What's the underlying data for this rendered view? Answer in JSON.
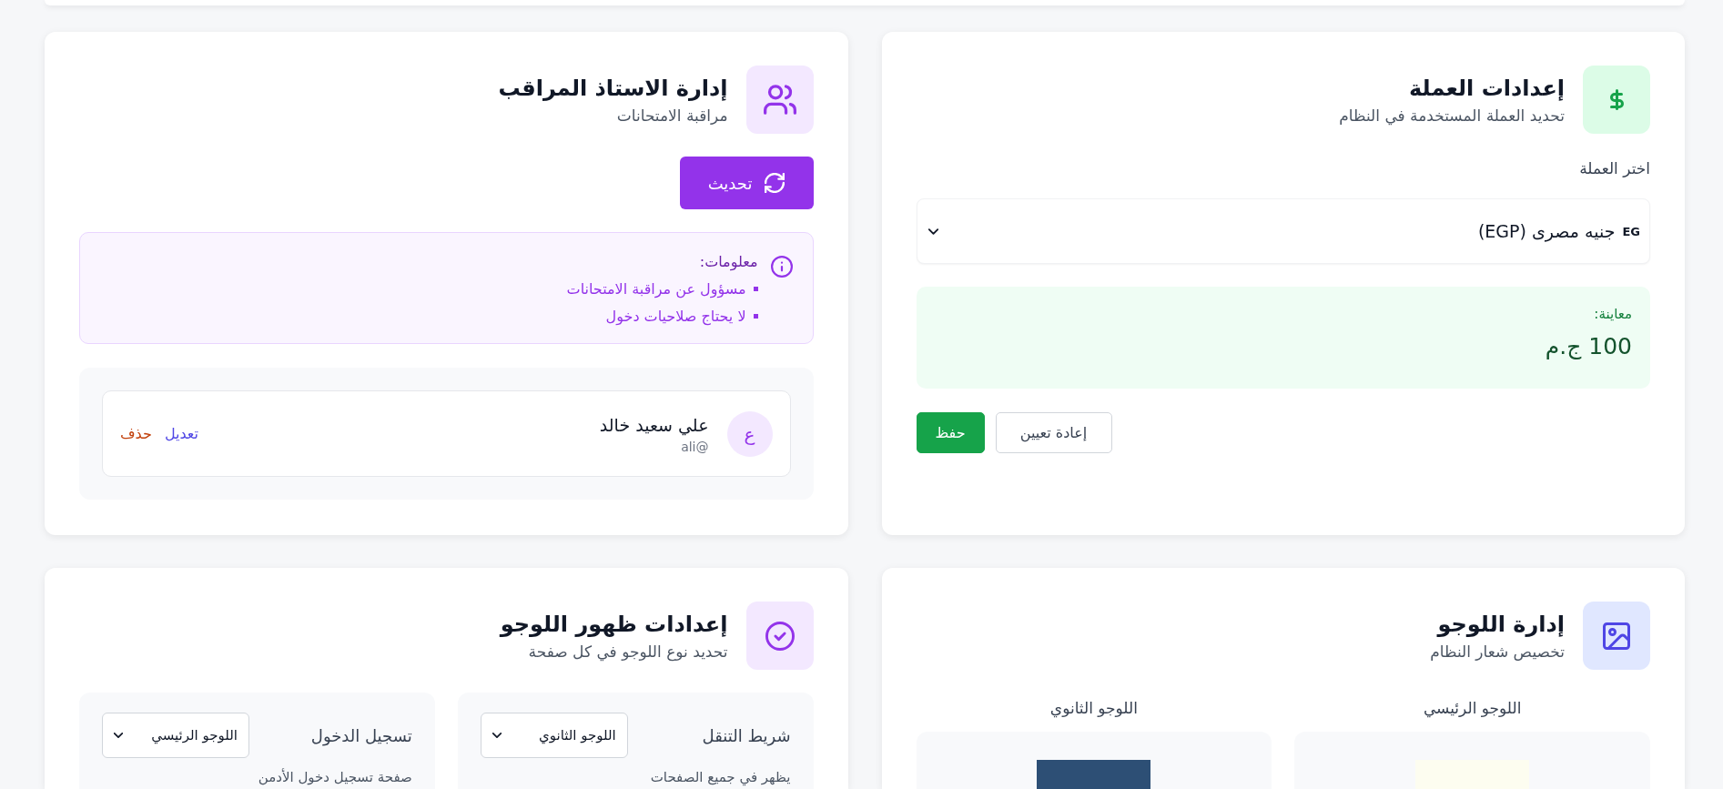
{
  "cards": [
    {
      "kind": "currency",
      "title": "إعدادات العملة",
      "subtitle": "تحديد العملة المستخدمة في النظام",
      "select": {
        "label": "اختر العملة",
        "flag": "EG",
        "value": "جنيه مصرى (EGP)"
      },
      "preview": {
        "label": "معاينة:",
        "value": "100 ج.م"
      },
      "buttons": [
        {
          "label": "إعادة تعيين",
          "kind": "reset"
        },
        {
          "label": "حفظ",
          "kind": "save"
        }
      ]
    },
    {
      "kind": "supervisor",
      "title": "إدارة الاستاذ المراقب",
      "subtitle": "مراقبة الامتحانات",
      "action": {
        "label": "تحديث"
      },
      "info": {
        "heading": "معلومات:",
        "items": [
          "مسؤول عن مراقبة الامتحانات",
          "لا يحتاج صلاحيات دخول"
        ]
      },
      "users": [
        {
          "initial": "ع",
          "name": "علي سعيد خالد",
          "handle": "ali@",
          "actions": [
            {
              "label": "تعديل",
              "kind": "edit"
            },
            {
              "label": "حذف",
              "kind": "delete"
            }
          ]
        }
      ]
    },
    {
      "kind": "logo_management",
      "title": "إدارة اللوجو",
      "subtitle": "تخصيص شعار النظام",
      "logos": [
        {
          "label": "اللوجو الرئيسي",
          "color": "#fdfdf0"
        },
        {
          "label": "اللوجو الثانوي",
          "color": "#2d4f75"
        }
      ]
    },
    {
      "kind": "logo_visibility",
      "title": "إعدادات ظهور اللوجو",
      "subtitle": "تحديد نوع اللوجو في كل صفحة",
      "pages": [
        {
          "label": "شريط التنقل",
          "value": "اللوجو الثانوي",
          "description": "يظهر في جميع الصفحات"
        },
        {
          "label": "تسجيل الدخول",
          "value": "اللوجو الرئيسي",
          "description": "صفحة تسجيل دخول الأدمن"
        }
      ]
    }
  ]
}
